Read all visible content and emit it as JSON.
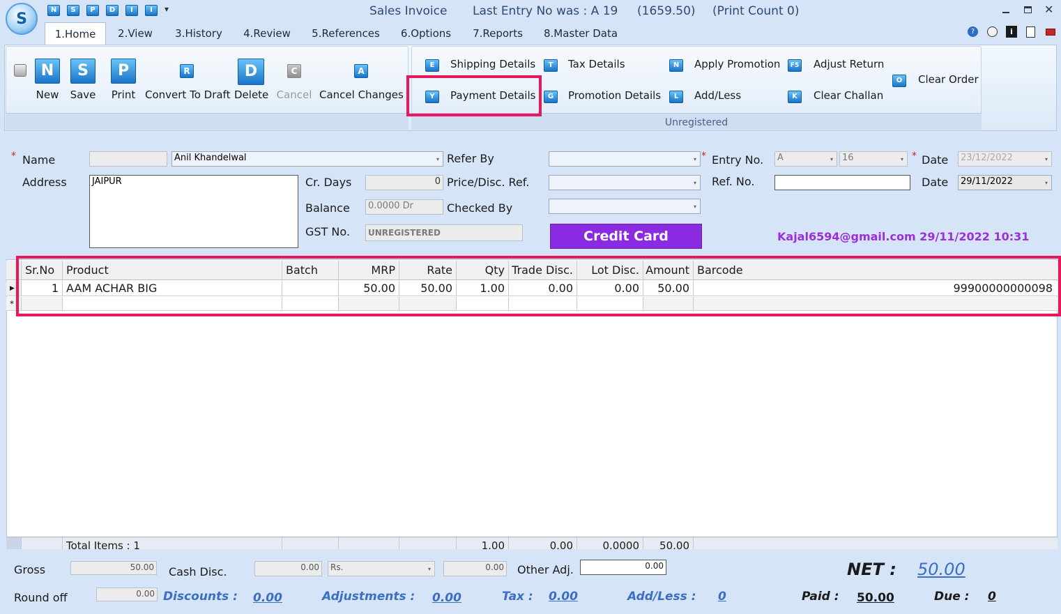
{
  "window": {
    "title": "Sales Invoice",
    "last_entry": "Last Entry No was : A 19",
    "last_amount": "(1659.50)",
    "print_count": "(Print Count 0)"
  },
  "qat": {
    "n": "N",
    "s": "S",
    "p": "P",
    "d": "D",
    "i1": "I",
    "i2": "I",
    "more": "▾"
  },
  "tabs": [
    {
      "label": "1.Home"
    },
    {
      "label": "2.View"
    },
    {
      "label": "3.History"
    },
    {
      "label": "4.Review"
    },
    {
      "label": "5.References"
    },
    {
      "label": "6.Options"
    },
    {
      "label": "7.Reports"
    },
    {
      "label": "8.Master Data"
    }
  ],
  "toolbar": {
    "new": {
      "label": "New",
      "key": "N"
    },
    "save": {
      "label": "Save",
      "key": "S"
    },
    "print": {
      "label": "Print",
      "key": "P"
    },
    "convert": {
      "label": "Convert To Draft",
      "key": "R"
    },
    "delete": {
      "label": "Delete",
      "key": "D"
    },
    "cancel": {
      "label": "Cancel",
      "key": "C"
    },
    "cancel_changes": {
      "label": "Cancel Changes",
      "key": "A"
    }
  },
  "actions": {
    "shipping": {
      "label": "Shipping Details",
      "key": "E"
    },
    "payment": {
      "label": "Payment Details",
      "key": "Y"
    },
    "tax": {
      "label": "Tax Details",
      "key": "T"
    },
    "promotion": {
      "label": "Promotion Details",
      "key": "G"
    },
    "apply_promo": {
      "label": "Apply Promotion",
      "key": "N"
    },
    "addless": {
      "label": "Add/Less",
      "key": "L"
    },
    "adjust_return": {
      "label": "Adjust Return",
      "key": "F5"
    },
    "clear_challan": {
      "label": "Clear Challan",
      "key": "K"
    },
    "clear_order": {
      "label": "Clear Order",
      "key": "O"
    },
    "status": "Unregistered"
  },
  "form": {
    "name_label": "Name",
    "name_value": "Anil Khandelwal",
    "address_label": "Address",
    "address_value": "JAIPUR",
    "crdays_label": "Cr. Days",
    "crdays_value": "0",
    "balance_label": "Balance",
    "balance_value": "0.0000 Dr",
    "gst_label": "GST No.",
    "gst_value": "UNREGISTERED",
    "referby_label": "Refer By",
    "pricedisc_label": "Price/Disc. Ref.",
    "checkedby_label": "Checked By",
    "entry_label": "Entry No.",
    "entry_series": "A",
    "entry_no": "16",
    "date_label": "Date",
    "date_value": "23/12/2022",
    "refno_label": "Ref. No.",
    "date2_label": "Date",
    "date2_value": "29/11/2022",
    "payment_mode": "Credit Card",
    "user_stamp": "Kajal6594@gmail.com 29/11/2022 10:31"
  },
  "grid": {
    "headers": [
      "Sr.No",
      "Product",
      "Batch",
      "MRP",
      "Rate",
      "Qty",
      "Trade Disc.",
      "Lot Disc.",
      "Amount",
      "Barcode"
    ],
    "rows": [
      [
        "1",
        "AAM ACHAR BIG",
        "",
        "50.00",
        "50.00",
        "1.00",
        "0.00",
        "0.00",
        "50.00",
        "99900000000098"
      ]
    ],
    "new_row_marker": "*",
    "current_row_marker": "▶",
    "totals": {
      "items": "Total Items : 1",
      "qty": "1.00",
      "trade": "0.00",
      "lot": "0.0000",
      "amount": "50.00"
    }
  },
  "footer": {
    "gross_label": "Gross",
    "gross_value": "50.00",
    "cash_label": "Cash Disc.",
    "cash_value": "0.00",
    "cash_unit": "Rs.",
    "cash_value2": "0.00",
    "other_label": "Other Adj.",
    "other_value": "0.00",
    "round_label": "Round off",
    "round_value": "0.00",
    "discounts_label": "Discounts :",
    "discounts_value": "0.00",
    "adjust_label": "Adjustments :",
    "adjust_value": "0.00",
    "tax_label": "Tax :",
    "tax_value": "0.00",
    "addless_label": "Add/Less :",
    "addless_value": "0",
    "net_label": "NET :",
    "net_value": "50.00",
    "paid_label": "Paid :",
    "paid_value": "50.00",
    "due_label": "Due :",
    "due_value": "0"
  },
  "colors": {
    "accent": "#8a2be2",
    "annotation": "#e8185a",
    "link": "#3b6fc4",
    "stamp": "#9b30d9"
  }
}
